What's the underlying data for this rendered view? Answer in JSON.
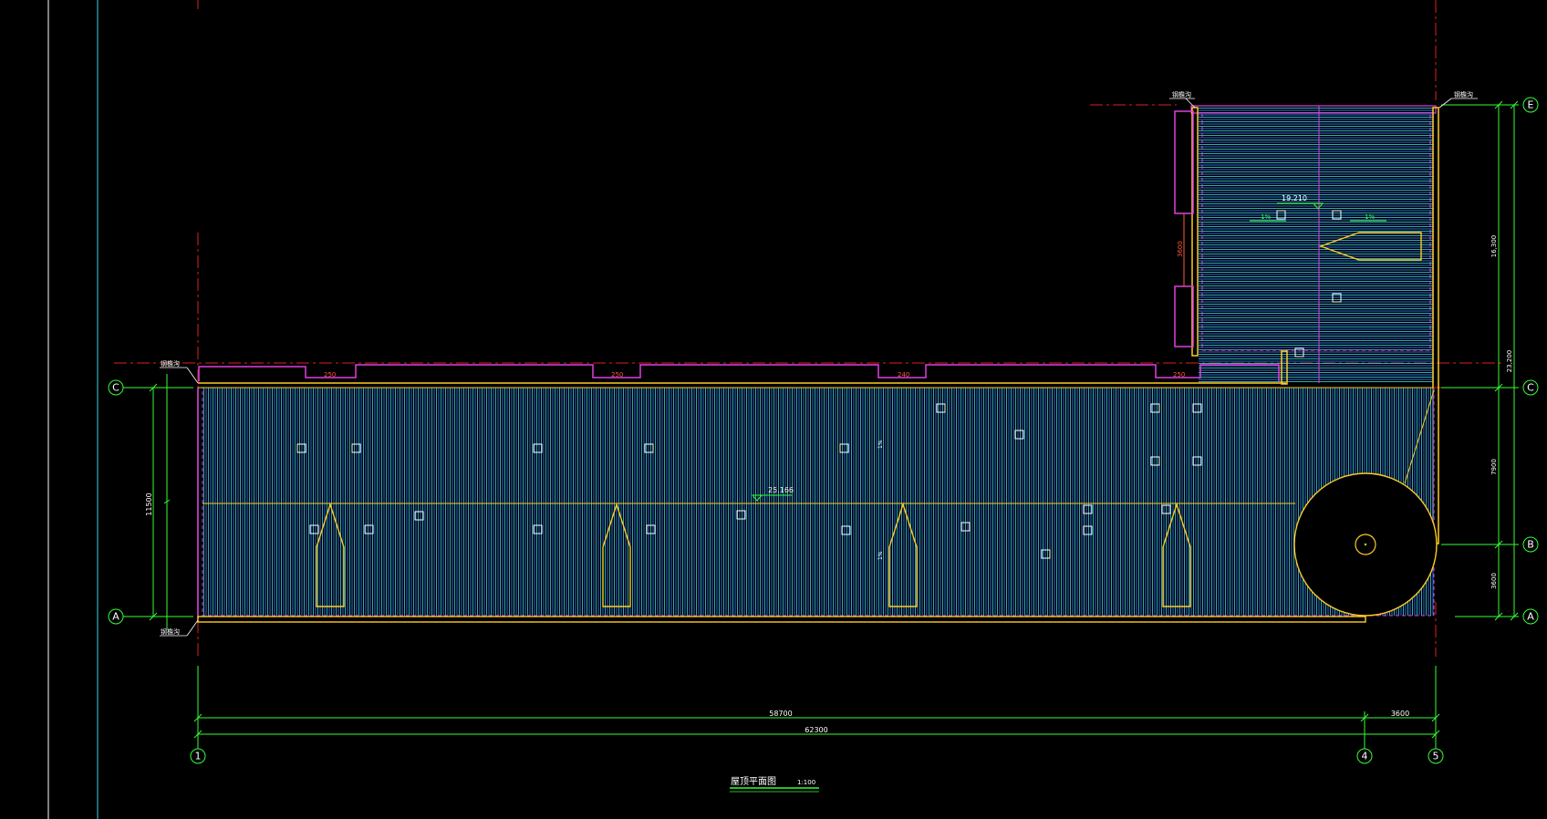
{
  "drawing_title": "屋顶平面图",
  "scale": "1:100",
  "grid_bubbles": {
    "rows": [
      "E",
      "C",
      "B",
      "A"
    ],
    "cols": [
      "1",
      "4",
      "5"
    ]
  },
  "dimensions": {
    "bottom_span_1_4": "58700",
    "bottom_span_4_5": "3600",
    "bottom_total": "62300",
    "left_a_c": "11500",
    "right_c_e": "16,300",
    "right_b_c": "7900",
    "right_a_b": "3600",
    "right_total": "23,200",
    "upper_wall": "3600",
    "openings": [
      "250",
      "250",
      "240",
      "250"
    ],
    "slopes": [
      "1%",
      "1%",
      "1%",
      "1%"
    ]
  },
  "elevations": {
    "main_roof": "25.166",
    "upper_roof": "19.210"
  },
  "labels": {
    "edge": "钢檐沟"
  },
  "colors": {
    "background": "#000000",
    "grid_red": "#e02020",
    "dim_green": "#33ff33",
    "cyan": "#37d6e6",
    "yellow": "#ffcc22",
    "magenta": "#e040e0",
    "blue_hatch": "#2f6bd8"
  }
}
